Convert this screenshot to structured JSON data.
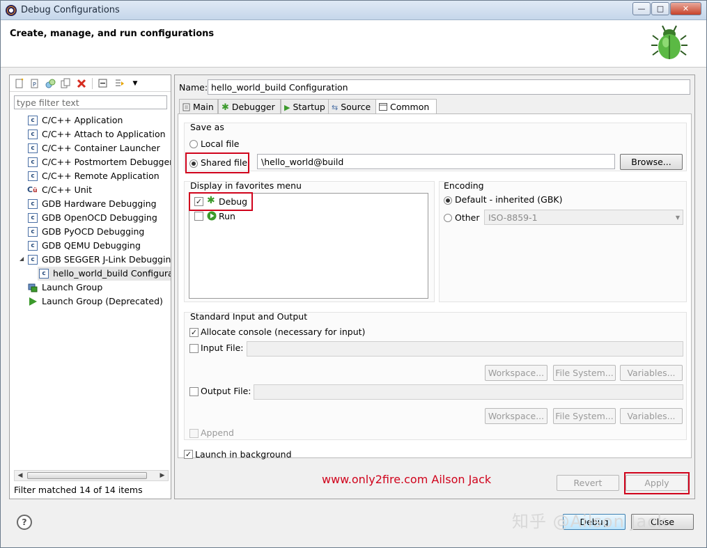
{
  "window": {
    "title": "Debug Configurations",
    "minimize": "—",
    "maximize": "□",
    "close": "✕"
  },
  "header": {
    "title": "Create, manage, and run configurations"
  },
  "toolbar": {
    "icons": [
      "new-launch-config-icon",
      "new-prototype-icon",
      "export-icon",
      "duplicate-icon",
      "delete-icon",
      "collapse-all-icon",
      "filter-icon",
      "view-menu-icon"
    ]
  },
  "filter": {
    "placeholder": "type filter text"
  },
  "tree": {
    "items": [
      {
        "label": "C/C++ Application",
        "icon": "c-file-icon"
      },
      {
        "label": "C/C++ Attach to Application",
        "icon": "c-file-icon"
      },
      {
        "label": "C/C++ Container Launcher",
        "icon": "c-file-icon"
      },
      {
        "label": "C/C++ Postmortem Debugger",
        "icon": "c-file-icon"
      },
      {
        "label": "C/C++ Remote Application",
        "icon": "c-file-icon"
      },
      {
        "label": "C/C++ Unit",
        "icon": "cu-unit-icon"
      },
      {
        "label": "GDB Hardware Debugging",
        "icon": "c-file-icon"
      },
      {
        "label": "GDB OpenOCD Debugging",
        "icon": "c-file-icon"
      },
      {
        "label": "GDB PyOCD Debugging",
        "icon": "c-file-icon"
      },
      {
        "label": "GDB QEMU Debugging",
        "icon": "c-file-icon"
      },
      {
        "label": "GDB SEGGER J-Link Debugging",
        "icon": "c-file-icon",
        "expanded": true
      },
      {
        "label": "hello_world_build Configuration",
        "icon": "c-file-icon",
        "child": true,
        "selected": true
      },
      {
        "label": "Launch Group",
        "icon": "launch-group-icon"
      },
      {
        "label": "Launch Group (Deprecated)",
        "icon": "run-icon"
      }
    ],
    "footer": "Filter matched 14 of 14 items"
  },
  "config": {
    "name_label": "Name:",
    "name_value": "hello_world_build Configuration",
    "tabs": [
      {
        "label": "Main",
        "icon": "main-tab-icon"
      },
      {
        "label": "Debugger",
        "icon": "debugger-tab-icon"
      },
      {
        "label": "Startup",
        "icon": "startup-tab-icon"
      },
      {
        "label": "Source",
        "icon": "source-tab-icon"
      },
      {
        "label": "Common",
        "icon": "common-tab-icon",
        "active": true
      }
    ],
    "save_as": {
      "title": "Save as",
      "local_label": "Local file",
      "shared_label": "Shared file:",
      "shared_selected": true,
      "shared_value": "\\hello_world@build",
      "browse_label": "Browse..."
    },
    "favorites": {
      "title": "Display in favorites menu",
      "items": [
        {
          "label": "Debug",
          "checked": true,
          "icon": "debug-icon"
        },
        {
          "label": "Run",
          "checked": false,
          "icon": "run-icon"
        }
      ]
    },
    "encoding": {
      "title": "Encoding",
      "default_label": "Default - inherited (GBK)",
      "default_selected": true,
      "other_label": "Other",
      "other_value": "ISO-8859-1"
    },
    "stdio": {
      "title": "Standard Input and Output",
      "allocate_label": "Allocate console (necessary for input)",
      "allocate_checked": true,
      "input_label": "Input File:",
      "output_label": "Output File:",
      "workspace_label": "Workspace...",
      "filesystem_label": "File System...",
      "variables_label": "Variables...",
      "append_label": "Append"
    },
    "background_label": "Launch in background",
    "background_checked": true,
    "watermark": "www.only2fire.com  Ailson Jack",
    "revert_label": "Revert",
    "apply_label": "Apply"
  },
  "footer": {
    "help_label": "?",
    "debug_label": "Debug",
    "close_label": "Close",
    "zhihu_watermark": "知乎 @Ailson Jack"
  },
  "colors": {
    "highlight": "#d0021b",
    "title_bar": "#c5d6ea",
    "accent_green": "#3c9a2c"
  }
}
